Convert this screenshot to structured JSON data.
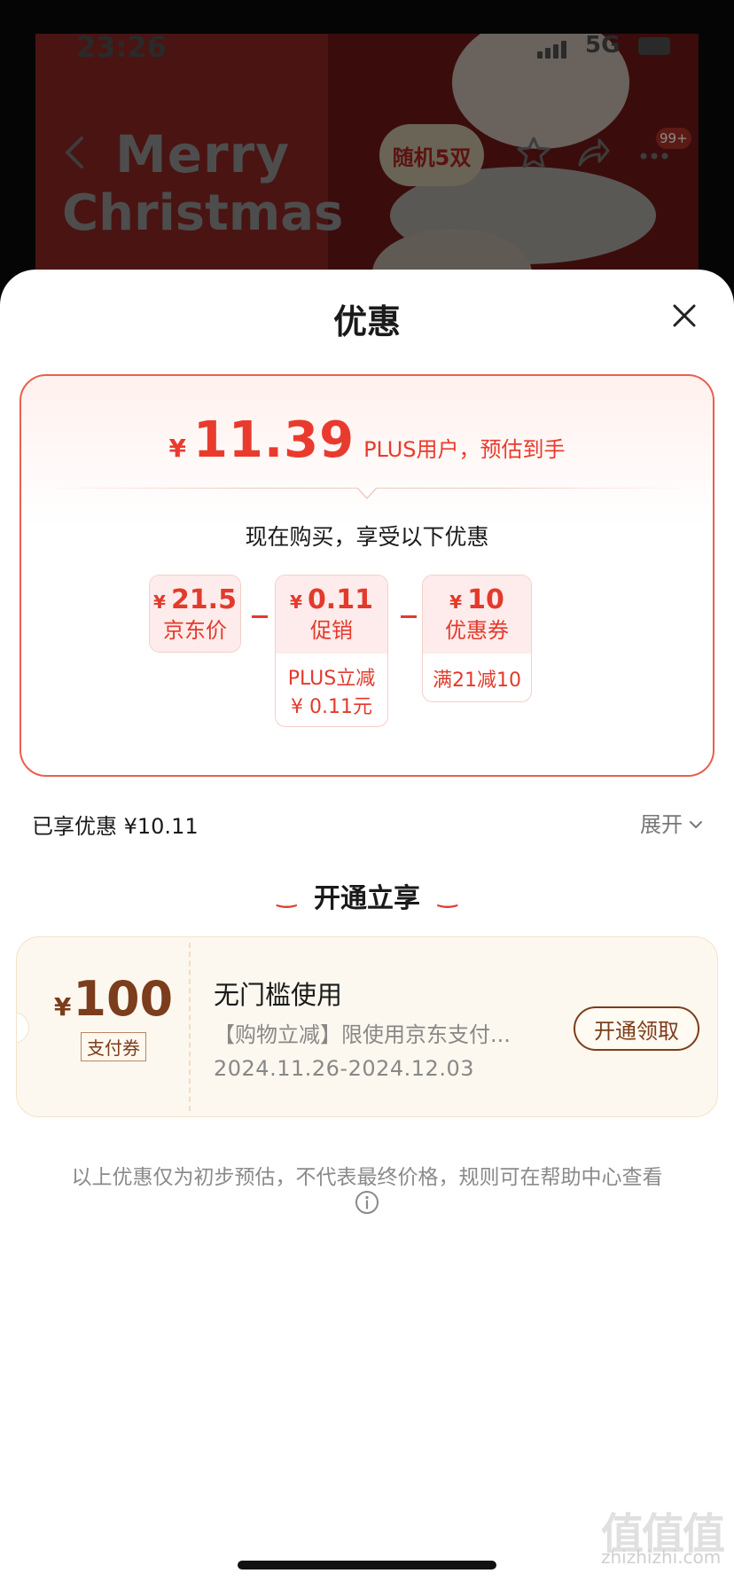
{
  "background": {
    "status": {
      "time": "23:26",
      "network": "5G"
    },
    "banner": {
      "line1": "Merry",
      "line2": "Christmas",
      "tag": "随机5双"
    },
    "badge": "99+"
  },
  "sheet": {
    "title": "优惠",
    "price": {
      "currency": "¥",
      "value": "11.39",
      "note": "PLUS用户，预估到手"
    },
    "enjoy_text": "现在购买，享受以下优惠",
    "breakdown": [
      {
        "currency": "¥",
        "amount": "21.5",
        "label": "京东价",
        "details": []
      },
      {
        "currency": "¥",
        "amount": "0.11",
        "label": "促销",
        "details": [
          "PLUS立减",
          "¥ 0.11元"
        ]
      },
      {
        "currency": "¥",
        "amount": "10",
        "label": "优惠券",
        "details": [
          "满21减10"
        ]
      }
    ],
    "enjoyed": "已享优惠 ¥10.11",
    "expand_label": "展开",
    "open_section_title": "开通立享",
    "coupon": {
      "currency": "¥",
      "amount": "100",
      "type_tag": "支付券",
      "title": "无门槛使用",
      "description": "【购物立减】限使用京东支付...",
      "date_range": "2024.11.26-2024.12.03",
      "button_label": "开通领取"
    },
    "disclaimer": "以上优惠仅为初步预估，不代表最终价格，规则可在帮助中心查看",
    "watermark": {
      "main": "值值值",
      "sub": "zhizhizhi.com"
    }
  },
  "colors": {
    "accent_red": "#e33a2c",
    "coupon_brown": "#7b3d1c",
    "card_border": "#e8604f"
  },
  "icons": [
    "back-arrow-icon",
    "star-icon",
    "share-icon",
    "more-icon",
    "close-icon",
    "chevron-down-icon",
    "info-icon"
  ]
}
